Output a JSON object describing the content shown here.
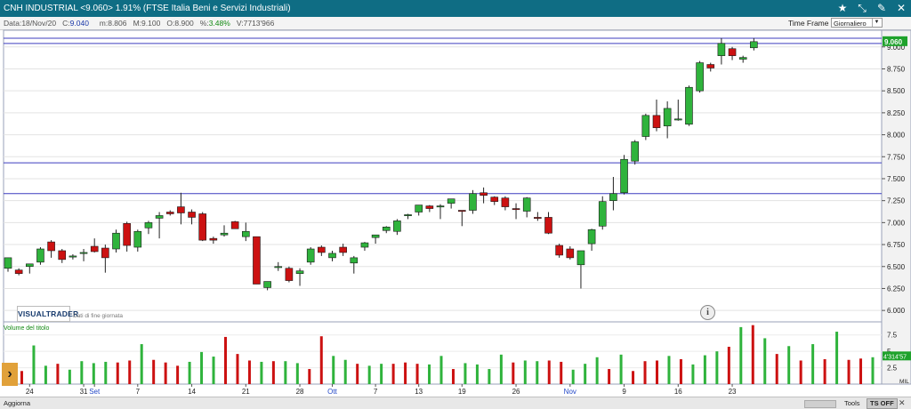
{
  "header": {
    "title": "CNH INDUSTRIAL <9.060> 1.91%  (FTSE Italia Beni e Servizi Industriali)",
    "icons": [
      "star-icon",
      "expand-icon",
      "pin-icon",
      "close-icon"
    ]
  },
  "infobar": {
    "date_label": "Data:",
    "date": "18/Nov/20",
    "close_label": "C:",
    "close": "9.040",
    "min_label": "m:",
    "min": "8.806",
    "max_label": "M:",
    "max": "9.100",
    "open_label": "O:",
    "open": "8.900",
    "pct_label": "%:",
    "pct": "3.48%",
    "vol_label": "V:",
    "vol": "7713'966",
    "timeframe_label": "Time Frame",
    "timeframe_value": "Giornaliero"
  },
  "overlay": {
    "logo": "VISUALTRADER",
    "logo_sub": "Dati di fine giornata",
    "info_icon": "i",
    "volume_title": "Volume del titolo",
    "price_tag": "9.060",
    "volume_tag": "4'314'57",
    "volume_unit": "MIL"
  },
  "bottombar": {
    "aggiorna": "Aggiorna",
    "tools": "Tools",
    "ts_off": "TS OFF"
  },
  "colors": {
    "up": "#2fb33c",
    "down": "#cc1111",
    "hline": "#3d3dbf",
    "titlebar": "#0f6d84"
  },
  "chart_data": {
    "type": "candlestick",
    "price_axis": {
      "ticks": [
        "9.000",
        "8.750",
        "8.500",
        "8.250",
        "8.000",
        "7.750",
        "7.500",
        "7.250",
        "7.000",
        "6.750",
        "6.500",
        "6.250",
        "6.000"
      ],
      "range": [
        5.87,
        9.19
      ]
    },
    "volume_axis": {
      "ticks": [
        "7.5",
        "5",
        "2.5"
      ],
      "unit": "MIL",
      "range": [
        0,
        9.5
      ]
    },
    "x_labels": [
      {
        "i": 2,
        "text": "24",
        "blue": false
      },
      {
        "i": 7,
        "text": "31",
        "blue": false
      },
      {
        "i": 8,
        "text": "Set",
        "blue": true
      },
      {
        "i": 12,
        "text": "7",
        "blue": false
      },
      {
        "i": 17,
        "text": "14",
        "blue": false
      },
      {
        "i": 22,
        "text": "21",
        "blue": false
      },
      {
        "i": 27,
        "text": "28",
        "blue": false
      },
      {
        "i": 30,
        "text": "Ott",
        "blue": true
      },
      {
        "i": 34,
        "text": "7",
        "blue": false
      },
      {
        "i": 38,
        "text": "13",
        "blue": false
      },
      {
        "i": 42,
        "text": "19",
        "blue": false
      },
      {
        "i": 47,
        "text": "26",
        "blue": false
      },
      {
        "i": 52,
        "text": "Nov",
        "blue": true
      },
      {
        "i": 57,
        "text": "9",
        "blue": false
      },
      {
        "i": 62,
        "text": "16",
        "blue": false
      },
      {
        "i": 67,
        "text": "23",
        "blue": false
      }
    ],
    "horizontal_lines": [
      9.04,
      7.68,
      7.33
    ],
    "candles": [
      [
        6.48,
        6.6,
        6.44,
        6.6
      ],
      [
        6.46,
        6.48,
        6.4,
        6.42
      ],
      [
        6.5,
        6.53,
        6.42,
        6.53
      ],
      [
        6.55,
        6.72,
        6.52,
        6.7
      ],
      [
        6.78,
        6.8,
        6.6,
        6.68
      ],
      [
        6.68,
        6.7,
        6.54,
        6.58
      ],
      [
        6.62,
        6.64,
        6.58,
        6.62
      ],
      [
        6.66,
        6.7,
        6.56,
        6.66
      ],
      [
        6.73,
        6.82,
        6.66,
        6.67
      ],
      [
        6.71,
        6.75,
        6.43,
        6.6
      ],
      [
        6.7,
        6.92,
        6.66,
        6.88
      ],
      [
        6.99,
        7.01,
        6.67,
        6.74
      ],
      [
        6.72,
        6.92,
        6.67,
        6.9
      ],
      [
        6.94,
        7.02,
        6.87,
        7.0
      ],
      [
        7.05,
        7.12,
        6.82,
        7.08
      ],
      [
        7.12,
        7.14,
        7.08,
        7.1
      ],
      [
        7.18,
        7.34,
        6.98,
        7.11
      ],
      [
        7.12,
        7.15,
        6.98,
        7.06
      ],
      [
        7.1,
        7.12,
        6.79,
        6.8
      ],
      [
        6.82,
        6.84,
        6.76,
        6.8
      ],
      [
        6.86,
        6.97,
        6.84,
        6.88
      ],
      [
        7.01,
        7.02,
        6.93,
        6.93
      ],
      [
        6.84,
        7.0,
        6.79,
        6.9
      ],
      [
        6.84,
        6.84,
        6.3,
        6.3
      ],
      [
        6.26,
        6.33,
        6.23,
        6.33
      ],
      [
        6.5,
        6.55,
        6.45,
        6.5
      ],
      [
        6.48,
        6.5,
        6.32,
        6.34
      ],
      [
        6.42,
        6.48,
        6.28,
        6.45
      ],
      [
        6.55,
        6.72,
        6.52,
        6.7
      ],
      [
        6.72,
        6.74,
        6.62,
        6.66
      ],
      [
        6.6,
        6.68,
        6.56,
        6.65
      ],
      [
        6.72,
        6.76,
        6.62,
        6.66
      ],
      [
        6.54,
        6.62,
        6.42,
        6.6
      ],
      [
        6.72,
        6.78,
        6.68,
        6.77
      ],
      [
        6.83,
        6.86,
        6.76,
        6.86
      ],
      [
        6.91,
        6.96,
        6.88,
        6.95
      ],
      [
        6.9,
        7.04,
        6.86,
        7.02
      ],
      [
        7.08,
        7.1,
        7.04,
        7.09
      ],
      [
        7.12,
        7.2,
        7.08,
        7.2
      ],
      [
        7.19,
        7.2,
        7.12,
        7.16
      ],
      [
        7.19,
        7.21,
        7.04,
        7.19
      ],
      [
        7.22,
        7.27,
        7.16,
        7.27
      ],
      [
        7.14,
        7.14,
        6.96,
        7.13
      ],
      [
        7.14,
        7.37,
        7.1,
        7.33
      ],
      [
        7.34,
        7.4,
        7.22,
        7.31
      ],
      [
        7.29,
        7.3,
        7.2,
        7.24
      ],
      [
        7.28,
        7.3,
        7.14,
        7.18
      ],
      [
        7.16,
        7.22,
        7.04,
        7.15
      ],
      [
        7.13,
        7.29,
        7.06,
        7.28
      ],
      [
        7.06,
        7.12,
        7.02,
        7.05
      ],
      [
        7.06,
        7.12,
        6.87,
        6.88
      ],
      [
        6.74,
        6.76,
        6.6,
        6.63
      ],
      [
        6.7,
        6.73,
        6.58,
        6.6
      ],
      [
        6.52,
        6.68,
        6.25,
        6.68
      ],
      [
        6.76,
        6.93,
        6.68,
        6.92
      ],
      [
        6.96,
        7.3,
        6.92,
        7.24
      ],
      [
        7.25,
        7.52,
        7.14,
        7.33
      ],
      [
        7.34,
        7.77,
        7.32,
        7.72
      ],
      [
        7.7,
        7.94,
        7.66,
        7.92
      ],
      [
        7.98,
        8.24,
        7.94,
        8.22
      ],
      [
        8.22,
        8.4,
        8.04,
        8.08
      ],
      [
        8.1,
        8.38,
        7.96,
        8.3
      ],
      [
        8.18,
        8.4,
        8.16,
        8.18
      ],
      [
        8.12,
        8.56,
        8.1,
        8.54
      ],
      [
        8.5,
        8.84,
        8.48,
        8.82
      ],
      [
        8.8,
        8.82,
        8.72,
        8.76
      ],
      [
        8.9,
        9.1,
        8.8,
        9.04
      ],
      [
        8.98,
        9.0,
        8.85,
        8.9
      ],
      [
        8.86,
        8.9,
        8.82,
        8.88
      ],
      [
        8.99,
        9.1,
        8.96,
        9.06
      ]
    ],
    "volumes": [
      [
        2.3,
        true
      ],
      [
        2.0,
        false
      ],
      [
        5.9,
        true
      ],
      [
        2.8,
        true
      ],
      [
        3.1,
        false
      ],
      [
        2.2,
        true
      ],
      [
        3.5,
        true
      ],
      [
        3.2,
        true
      ],
      [
        3.4,
        true
      ],
      [
        3.3,
        false
      ],
      [
        3.6,
        false
      ],
      [
        6.1,
        true
      ],
      [
        3.7,
        false
      ],
      [
        3.3,
        false
      ],
      [
        2.8,
        false
      ],
      [
        3.4,
        true
      ],
      [
        4.9,
        true
      ],
      [
        4.2,
        true
      ],
      [
        7.2,
        false
      ],
      [
        4.6,
        false
      ],
      [
        3.6,
        false
      ],
      [
        3.4,
        true
      ],
      [
        3.5,
        false
      ],
      [
        3.5,
        true
      ],
      [
        3.2,
        true
      ],
      [
        2.3,
        false
      ],
      [
        7.3,
        false
      ],
      [
        4.3,
        true
      ],
      [
        3.7,
        true
      ],
      [
        3.1,
        false
      ],
      [
        2.8,
        true
      ],
      [
        3.1,
        true
      ],
      [
        3.1,
        false
      ],
      [
        3.3,
        false
      ],
      [
        3.1,
        false
      ],
      [
        3.0,
        true
      ],
      [
        4.3,
        true
      ],
      [
        2.3,
        false
      ],
      [
        3.2,
        true
      ],
      [
        3.0,
        true
      ],
      [
        2.3,
        true
      ],
      [
        4.5,
        true
      ],
      [
        3.3,
        false
      ],
      [
        3.6,
        true
      ],
      [
        3.5,
        true
      ],
      [
        3.6,
        false
      ],
      [
        3.4,
        false
      ],
      [
        2.2,
        true
      ],
      [
        3.1,
        true
      ],
      [
        4.1,
        true
      ],
      [
        2.3,
        false
      ],
      [
        4.5,
        true
      ],
      [
        2.0,
        false
      ],
      [
        3.5,
        false
      ],
      [
        3.6,
        false
      ],
      [
        4.3,
        true
      ],
      [
        3.8,
        false
      ],
      [
        3.0,
        true
      ],
      [
        4.4,
        true
      ],
      [
        5.0,
        true
      ],
      [
        5.7,
        false
      ],
      [
        8.7,
        true
      ],
      [
        9.0,
        false
      ],
      [
        7.0,
        true
      ],
      [
        4.6,
        false
      ],
      [
        5.8,
        true
      ],
      [
        3.6,
        false
      ],
      [
        6.1,
        true
      ],
      [
        3.8,
        false
      ],
      [
        8.0,
        true
      ],
      [
        3.7,
        false
      ],
      [
        3.9,
        false
      ],
      [
        4.1,
        true
      ]
    ]
  }
}
